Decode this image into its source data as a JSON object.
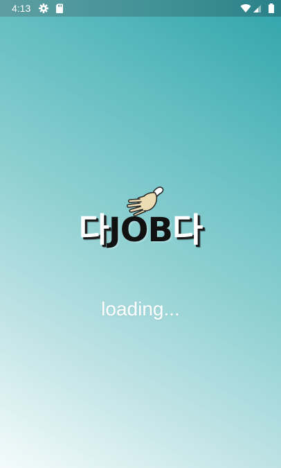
{
  "status_bar": {
    "time": "4:13",
    "icons": [
      "gear-icon",
      "sd-card-icon",
      "wifi-icon",
      "signal-icon",
      "battery-icon"
    ]
  },
  "logo": {
    "prefix": "다",
    "middle": "JOB",
    "suffix": "다",
    "icon": "hand-icon"
  },
  "loading_text": "loading...",
  "colors": {
    "status_bar": "#3f9095",
    "gradient_top_right": "#2fa4aa",
    "gradient_bottom_left": "#f4fbfb",
    "logo_black": "#111111",
    "hand": "#ecdcb3"
  }
}
